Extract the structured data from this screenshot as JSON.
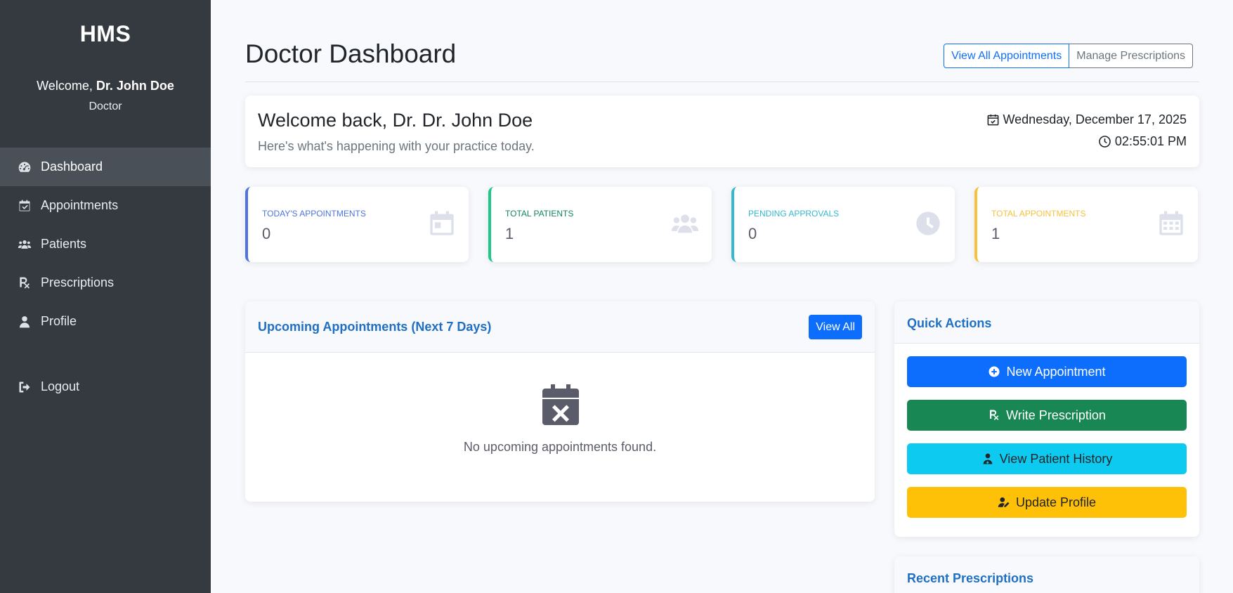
{
  "sidebar": {
    "brand": "HMS",
    "welcome_prefix": "Welcome, ",
    "user_name": "Dr. John Doe",
    "role": "Doctor",
    "items": [
      {
        "label": "Dashboard",
        "icon": "tachometer-icon",
        "active": true
      },
      {
        "label": "Appointments",
        "icon": "calendar-check-icon",
        "active": false
      },
      {
        "label": "Patients",
        "icon": "users-icon",
        "active": false
      },
      {
        "label": "Prescriptions",
        "icon": "prescription-icon",
        "active": false
      },
      {
        "label": "Profile",
        "icon": "user-icon",
        "active": false
      }
    ],
    "logout": {
      "label": "Logout",
      "icon": "sign-out-icon"
    }
  },
  "header": {
    "title": "Doctor Dashboard",
    "view_all_appointments": "View All Appointments",
    "manage_prescriptions": "Manage Prescriptions"
  },
  "welcome_card": {
    "title": "Welcome back, Dr. Dr. John Doe",
    "subtitle": "Here's what's happening with your practice today.",
    "date": "Wednesday, December 17, 2025",
    "time": "02:55:01 PM"
  },
  "stats": [
    {
      "label": "TODAY'S APPOINTMENTS",
      "value": "0",
      "color": "#4e73df",
      "icon": "calendar-icon"
    },
    {
      "label": "TOTAL PATIENTS",
      "value": "1",
      "color": "#1cc88a",
      "icon": "users-icon"
    },
    {
      "label": "PENDING APPROVALS",
      "value": "0",
      "color": "#36b9cc",
      "icon": "clock-icon"
    },
    {
      "label": "TOTAL APPOINTMENTS",
      "value": "1",
      "color": "#f6c23e",
      "icon": "calendar-alt-icon"
    }
  ],
  "upcoming": {
    "title": "Upcoming Appointments (Next 7 Days)",
    "view_all": "View All",
    "empty_text": "No upcoming appointments found."
  },
  "quick_actions": {
    "title": "Quick Actions",
    "buttons": [
      {
        "label": "New Appointment",
        "bg": "#0d6efd",
        "fg": "#ffffff",
        "icon": "plus-circle-icon"
      },
      {
        "label": "Write Prescription",
        "bg": "#198754",
        "fg": "#ffffff",
        "icon": "prescription-icon"
      },
      {
        "label": "View Patient History",
        "bg": "#0dcaf0",
        "fg": "#212529",
        "icon": "user-doctor-icon"
      },
      {
        "label": "Update Profile",
        "bg": "#ffc107",
        "fg": "#212529",
        "icon": "user-edit-icon"
      }
    ]
  },
  "recent_prescriptions": {
    "title": "Recent Prescriptions"
  }
}
